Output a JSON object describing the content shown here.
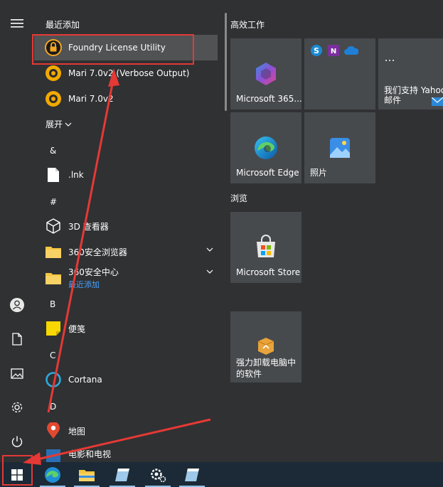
{
  "recent": {
    "title": "最近添加",
    "items": [
      {
        "label": "Foundry License Utility"
      },
      {
        "label": "Mari 7.0v2 (Verbose Output)"
      },
      {
        "label": "Mari 7.0v2"
      }
    ]
  },
  "expand_label": "展开",
  "letters": {
    "amp": "&",
    "hash": "#",
    "b": "B",
    "c": "C",
    "d": "D"
  },
  "apps": {
    "lnk": ".lnk",
    "viewer3d": "3D 查看器",
    "browser360": "360安全浏览器",
    "security360": "360安全中心",
    "security360_sub": "最近添加",
    "sticky": "便笺",
    "cortana": "Cortana",
    "maps": "地图",
    "cut_off": "电影和电视"
  },
  "tiles": {
    "group1": "高效工作",
    "m365": "Microsoft 365...",
    "yahoo_line1": "我们支持 Yahoo",
    "yahoo_line2": "邮件",
    "edge": "Microsoft Edge",
    "photos": "照片",
    "group2": "浏览",
    "store": "Microsoft Store",
    "uninstall_line1": "强力卸载电脑中",
    "uninstall_line2": "的软件"
  },
  "colors": {
    "annotation": "#e53935",
    "link": "#4aa3ff",
    "tile": "#474a4d",
    "highlight": "#505254"
  }
}
